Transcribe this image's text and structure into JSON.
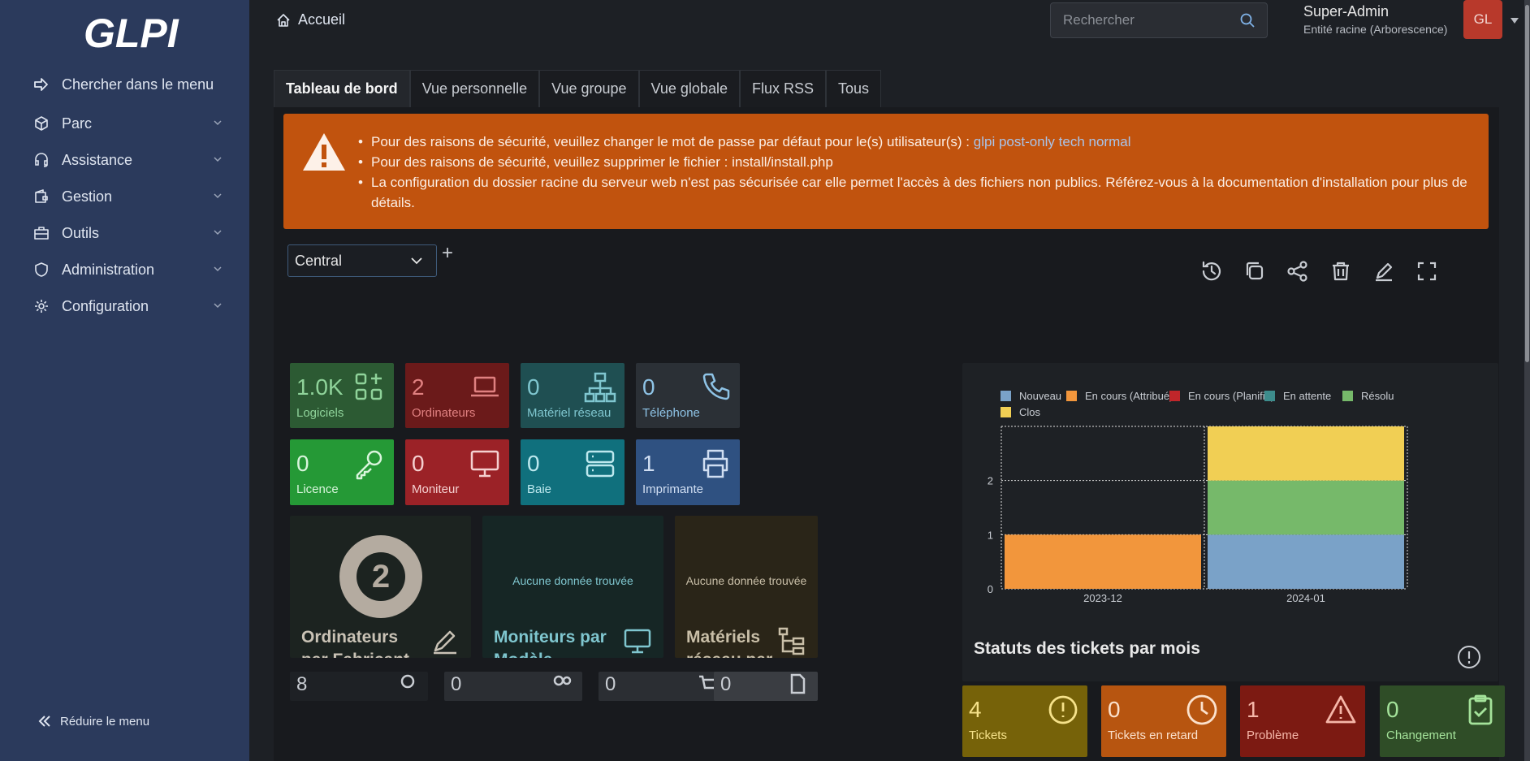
{
  "sidebar": {
    "logo_text": "GLPI",
    "items": [
      {
        "label": "Chercher dans le menu",
        "icon": "arrow-right-to-bracket-icon"
      },
      {
        "label": "Parc",
        "icon": "cube-icon"
      },
      {
        "label": "Assistance",
        "icon": "headset-icon"
      },
      {
        "label": "Gestion",
        "icon": "wallet-icon"
      },
      {
        "label": "Outils",
        "icon": "briefcase-icon"
      },
      {
        "label": "Administration",
        "icon": "shield-icon"
      },
      {
        "label": "Configuration",
        "icon": "gear-icon"
      }
    ],
    "collapse_label": "Réduire le menu"
  },
  "header": {
    "breadcrumb": "Accueil",
    "search_placeholder": "Rechercher",
    "user_name": "Super-Admin",
    "user_entity": "Entité racine (Arborescence)",
    "avatar_initials": "GL"
  },
  "tabs": [
    "Tableau de bord",
    "Vue personnelle",
    "Vue groupe",
    "Vue globale",
    "Flux RSS",
    "Tous"
  ],
  "alert": {
    "line1_prefix": "Pour des raisons de sécurité, veuillez changer le mot de passe par défaut pour le(s) utilisateur(s) : ",
    "line1_link": "glpi post-only tech normal",
    "line2": "Pour des raisons de sécurité, veuillez supprimer le fichier : install/install.php",
    "line3": "La configuration du dossier racine du serveur web n'est pas sécurisée car elle permet l'accès à des fichiers non publics. Référez-vous à la documentation d'installation pour plus de détails."
  },
  "dashboard": {
    "selected": "Central",
    "add_symbol": "+"
  },
  "cards": [
    {
      "value": "1.0K",
      "label": "Logiciels",
      "bg": "#2c5a33",
      "fg": "#8fd39a"
    },
    {
      "value": "2",
      "label": "Ordinateurs",
      "bg": "#6b1a1a",
      "fg": "#e08080"
    },
    {
      "value": "0",
      "label": "Matériel réseau",
      "bg": "#1f4f52",
      "fg": "#7fc6cf"
    },
    {
      "value": "0",
      "label": "Téléphone",
      "bg": "#2b3036",
      "fg": "#8ec3e6"
    },
    {
      "value": "0",
      "label": "Licence",
      "bg": "#259936",
      "fg": "#d9f5dc"
    },
    {
      "value": "0",
      "label": "Moniteur",
      "bg": "#9b2227",
      "fg": "#f5d0d0"
    },
    {
      "value": "0",
      "label": "Baie",
      "bg": "#10707d",
      "fg": "#bde8ee"
    },
    {
      "value": "1",
      "label": "Imprimante",
      "bg": "#2f5181",
      "fg": "#d0def2"
    }
  ],
  "big_cards": [
    {
      "title": "Ordinateurs par Fabricant",
      "value": "2"
    },
    {
      "title": "Moniteurs par Modèle",
      "empty": "Aucune donnée trouvée"
    },
    {
      "title": "Matériels réseau par",
      "empty": "Aucune donnée trouvée"
    }
  ],
  "bottom_cards": [
    {
      "value": "4",
      "label": "Tickets",
      "bg": "#766209",
      "fg": "#f6e28a"
    },
    {
      "value": "0",
      "label": "Tickets en retard",
      "bg": "#b75510",
      "fg": "#fbe1cc"
    },
    {
      "value": "1",
      "label": "Problème",
      "bg": "#7c1a12",
      "fg": "#f5b6a8"
    },
    {
      "value": "0",
      "label": "Changement",
      "bg": "#2f4d27",
      "fg": "#a4e29a"
    }
  ],
  "small_cards": [
    {
      "value": "8"
    },
    {
      "value": "0"
    },
    {
      "value": "0"
    },
    {
      "value": "0"
    }
  ],
  "chart_data": {
    "type": "bar",
    "title": "Statuts des tickets par mois",
    "categories": [
      "2023-12",
      "2024-01"
    ],
    "ylim": [
      0,
      3
    ],
    "yticks": [
      0,
      1,
      2
    ],
    "stacked": true,
    "legend_position": "top",
    "series": [
      {
        "name": "Nouveau",
        "color": "#7aa2c8",
        "values": [
          0,
          1
        ]
      },
      {
        "name": "En cours (Attribué)",
        "color": "#f2963c",
        "values": [
          1,
          0
        ]
      },
      {
        "name": "En cours (Planifié)",
        "color": "#c0262a",
        "values": [
          0,
          0
        ]
      },
      {
        "name": "En attente",
        "color": "#3d8c8c",
        "values": [
          0,
          0
        ]
      },
      {
        "name": "Résolu",
        "color": "#76b96a",
        "values": [
          0,
          1
        ]
      },
      {
        "name": "Clos",
        "color": "#f1cf54",
        "values": [
          0,
          1
        ]
      }
    ]
  }
}
